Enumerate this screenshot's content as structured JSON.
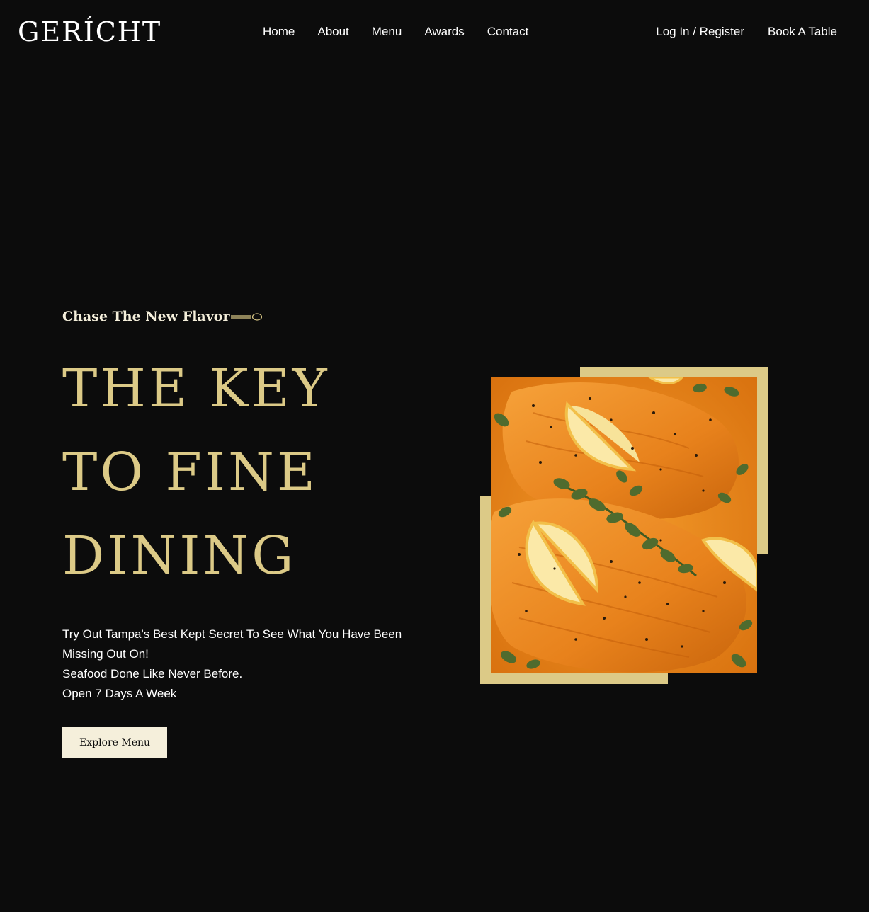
{
  "nav": {
    "logo": "GERÍCHT",
    "links": [
      "Home",
      "About",
      "Menu",
      "Awards",
      "Contact"
    ],
    "login": "Log In / Register",
    "book": "Book A Table"
  },
  "hero": {
    "subtitle": "Chase The New Flavor",
    "headline": [
      "THE KEY",
      "TO FINE",
      "DINING"
    ],
    "description": [
      "Try Out Tampa's Best Kept Secret To See What You Have Been",
      "Missing Out On!",
      "Seafood Done Like Never Before.",
      "Open 7 Days A Week"
    ],
    "button": "Explore Menu"
  },
  "colors": {
    "background": "#0c0c0c",
    "gold": "#dcca87",
    "cream": "#f5efdb"
  },
  "icons": [
    "spoon-icon"
  ]
}
